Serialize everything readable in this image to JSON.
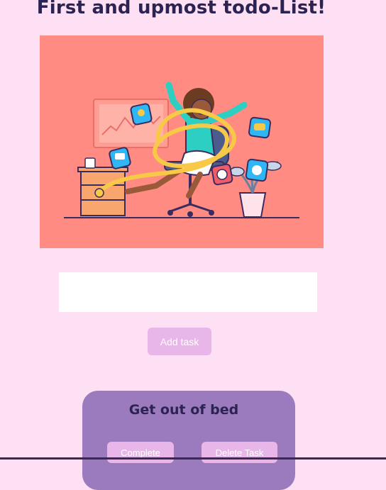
{
  "page": {
    "title": "First and upmost todo-List!"
  },
  "hero_image": {
    "description_icon": "woman-in-office-chair-with-measuring-tape-illustration"
  },
  "task_input": {
    "value": "",
    "placeholder": ""
  },
  "add_button": {
    "label": "Add task"
  },
  "tasks": [
    {
      "text": "Get out of bed",
      "complete_label": "Complete",
      "delete_label": "Delete Task"
    }
  ],
  "colors": {
    "background": "#fde0f3",
    "title": "#2b2352",
    "hero_bg": "#ff8b82",
    "button": "#e9b6ea",
    "card": "#9b7bbd"
  }
}
